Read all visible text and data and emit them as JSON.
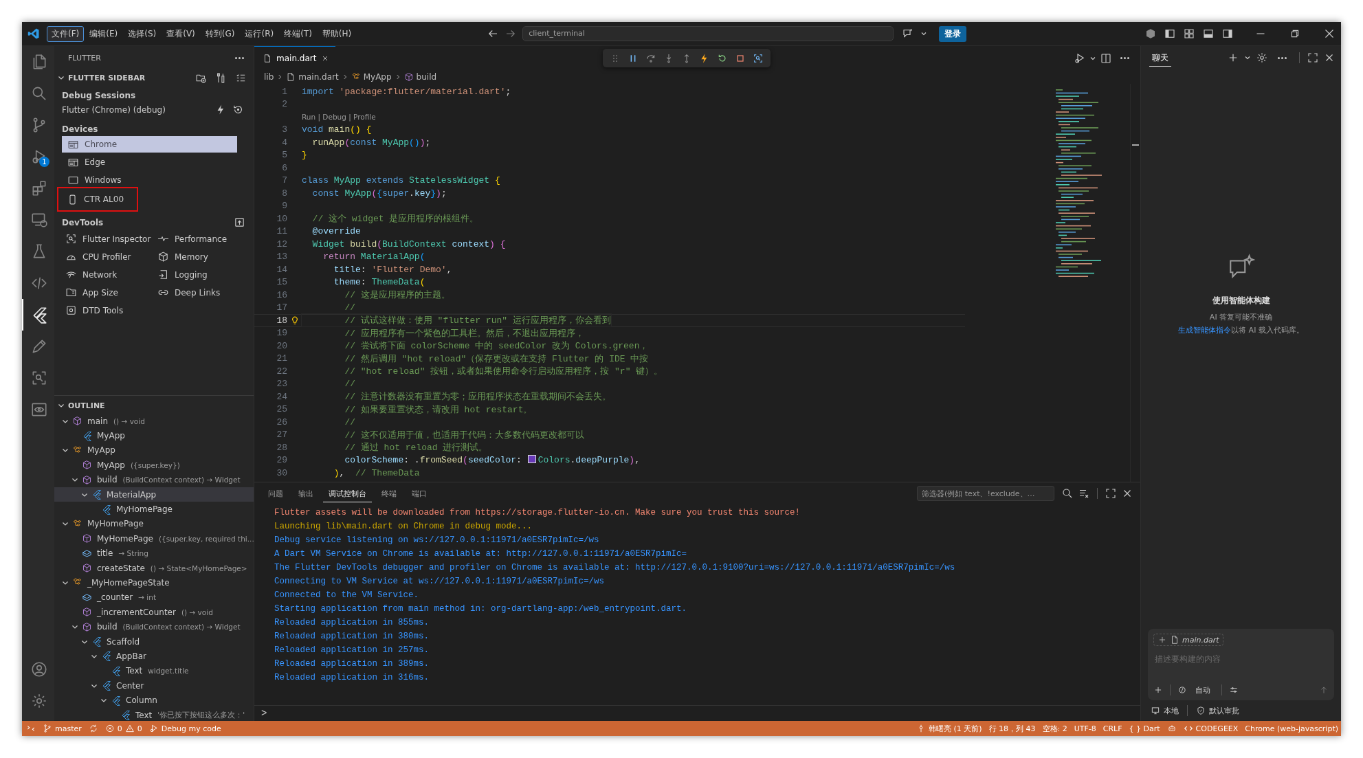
{
  "menu_bar": [
    {
      "label": "文件(F)",
      "selected": true
    },
    {
      "label": "编辑(E)",
      "selected": false
    },
    {
      "label": "选择(S)",
      "selected": false
    },
    {
      "label": "查看(V)",
      "selected": false
    },
    {
      "label": "转到(G)",
      "selected": false
    },
    {
      "label": "运行(R)",
      "selected": false
    },
    {
      "label": "终端(T)",
      "selected": false
    },
    {
      "label": "帮助(H)",
      "selected": false
    }
  ],
  "command_center": {
    "value": "client_terminal"
  },
  "sign_in_button": "登录",
  "activity_bar": [
    {
      "selected": false
    },
    {
      "selected": false
    },
    {
      "selected": false
    },
    {
      "selected": false,
      "badge": "1"
    },
    {
      "selected": false
    },
    {
      "selected": false
    },
    {
      "selected": false
    },
    {
      "selected": false
    },
    {
      "selected": true
    },
    {
      "selected": false
    },
    {
      "selected": false
    },
    {
      "selected": false
    }
  ],
  "sidebar": {
    "title": "FLUTTER",
    "section": {
      "title": "FLUTTER SIDEBAR",
      "expanded": true
    },
    "debug_sessions": {
      "heading": "Debug Sessions",
      "sessions": [
        "Flutter (Chrome) (debug)"
      ]
    },
    "devices": {
      "heading": "Devices",
      "items": [
        {
          "kind": "browser",
          "label": "Chrome",
          "selected": true,
          "annotated": false
        },
        {
          "kind": "browser",
          "label": "Edge",
          "selected": false,
          "annotated": false
        },
        {
          "kind": "desktop",
          "label": "Windows",
          "selected": false,
          "annotated": false
        },
        {
          "kind": "phone",
          "label": "CTR AL00",
          "selected": false,
          "annotated": true
        }
      ]
    },
    "devtools": {
      "heading": "DevTools",
      "items": [
        "Flutter Inspector",
        "Performance",
        "CPU Profiler",
        "Memory",
        "Network",
        "Logging",
        "App Size",
        "Deep Links",
        "DTD Tools"
      ]
    },
    "outline": {
      "title": "OUTLINE",
      "expanded": true,
      "items": [
        {
          "kind": "function",
          "name": "main",
          "detail": "() → void",
          "expanded": true,
          "selected": false,
          "children": [
            {
              "kind": "widget",
              "name": "MyApp",
              "selected": false
            }
          ]
        },
        {
          "kind": "class",
          "name": "MyApp",
          "expanded": true,
          "selected": false,
          "children": [
            {
              "kind": "function",
              "name": "MyApp",
              "detail": "({super.key})",
              "selected": false
            },
            {
              "kind": "function",
              "name": "build",
              "detail": "(BuildContext context) → Widget",
              "expanded": true,
              "selected": false,
              "children": [
                {
                  "kind": "widget",
                  "name": "MaterialApp",
                  "expanded": true,
                  "selected": true,
                  "children": [
                    {
                      "kind": "widget",
                      "name": "MyHomePage",
                      "selected": false
                    }
                  ]
                }
              ]
            }
          ]
        },
        {
          "kind": "class",
          "name": "MyHomePage",
          "expanded": true,
          "selected": false,
          "children": [
            {
              "kind": "function",
              "name": "MyHomePage",
              "detail": "({super.key, required thi...",
              "selected": false
            },
            {
              "kind": "field",
              "name": "title",
              "detail": "→ String",
              "selected": false
            },
            {
              "kind": "function",
              "name": "createState",
              "detail": "() → State<MyHomePage>",
              "selected": false
            }
          ]
        },
        {
          "kind": "class",
          "name": "_MyHomePageState",
          "expanded": true,
          "selected": false,
          "children": [
            {
              "kind": "field",
              "name": "_counter",
              "detail": "→ int",
              "selected": false
            },
            {
              "kind": "function",
              "name": "_incrementCounter",
              "detail": "() → void",
              "selected": false
            },
            {
              "kind": "function",
              "name": "build",
              "detail": "(BuildContext context) → Widget",
              "expanded": true,
              "selected": false,
              "children": [
                {
                  "kind": "widget",
                  "name": "Scaffold",
                  "expanded": true,
                  "selected": false,
                  "children": [
                    {
                      "kind": "widget",
                      "name": "AppBar",
                      "expanded": true,
                      "selected": false,
                      "children": [
                        {
                          "kind": "widget",
                          "name": "Text",
                          "detail": "widget.title",
                          "selected": false
                        }
                      ]
                    },
                    {
                      "kind": "widget",
                      "name": "Center",
                      "expanded": true,
                      "selected": false,
                      "children": [
                        {
                          "kind": "widget",
                          "name": "Column",
                          "expanded": true,
                          "selected": false,
                          "children": [
                            {
                              "kind": "widget",
                              "name": "Text",
                              "detail": "'你已按下按钮这么多次：'",
                              "selected": false
                            }
                          ]
                        }
                      ]
                    }
                  ]
                }
              ]
            }
          ]
        }
      ]
    }
  },
  "editor": {
    "tabs": [
      {
        "label": "main.dart",
        "selected": true
      }
    ],
    "breadcrumb": [
      {
        "kind": "folder",
        "label": "lib"
      },
      {
        "kind": "file",
        "label": "main.dart"
      },
      {
        "kind": "class",
        "label": "MyApp"
      },
      {
        "kind": "method",
        "label": "build"
      }
    ],
    "lines": [
      {
        "kind": "code",
        "number": "1",
        "current": false,
        "segments": [
          {
            "kind": "keyword",
            "text": "import "
          },
          {
            "kind": "string",
            "text": "'package:flutter/material.dart'"
          },
          {
            "kind": "plain",
            "text": ";"
          }
        ]
      },
      {
        "kind": "code",
        "number": "2",
        "current": false
      },
      {
        "kind": "lens",
        "text": "Run | Debug | Profile"
      },
      {
        "kind": "code",
        "number": "3",
        "current": false,
        "segments": [
          {
            "kind": "keyword",
            "text": "void "
          },
          {
            "kind": "function",
            "text": "main"
          },
          {
            "kind": "bracket1",
            "text": "() {"
          }
        ]
      },
      {
        "kind": "code",
        "number": "4",
        "current": false,
        "segments": [
          {
            "kind": "function",
            "text": "  runApp"
          },
          {
            "kind": "bracket2",
            "text": "("
          },
          {
            "kind": "keyword",
            "text": "const "
          },
          {
            "kind": "type",
            "text": "MyApp"
          },
          {
            "kind": "bracket3",
            "text": "()"
          },
          {
            "kind": "bracket2",
            "text": ")"
          },
          {
            "kind": "plain",
            "text": ";"
          }
        ]
      },
      {
        "kind": "code",
        "number": "5",
        "current": false,
        "segments": [
          {
            "kind": "bracket1",
            "text": "}"
          }
        ]
      },
      {
        "kind": "code",
        "number": "6",
        "current": false
      },
      {
        "kind": "code",
        "number": "7",
        "current": false,
        "segments": [
          {
            "kind": "keyword",
            "text": "class "
          },
          {
            "kind": "type",
            "text": "MyApp "
          },
          {
            "kind": "keyword",
            "text": "extends "
          },
          {
            "kind": "type",
            "text": "StatelessWidget "
          },
          {
            "kind": "bracket1",
            "text": "{"
          }
        ]
      },
      {
        "kind": "code",
        "number": "8",
        "current": false,
        "segments": [
          {
            "kind": "keyword",
            "text": "  const "
          },
          {
            "kind": "type",
            "text": "MyApp"
          },
          {
            "kind": "bracket2",
            "text": "("
          },
          {
            "kind": "bracket3",
            "text": "{"
          },
          {
            "kind": "keyword",
            "text": "super"
          },
          {
            "kind": "plain",
            "text": "."
          },
          {
            "kind": "variable",
            "text": "key"
          },
          {
            "kind": "bracket3",
            "text": "}"
          },
          {
            "kind": "bracket2",
            "text": ")"
          },
          {
            "kind": "plain",
            "text": ";"
          }
        ]
      },
      {
        "kind": "code",
        "number": "9",
        "current": false
      },
      {
        "kind": "code",
        "number": "10",
        "current": false,
        "segments": [
          {
            "kind": "comment",
            "text": "  // 这个 widget 是应用程序的根组件。"
          }
        ]
      },
      {
        "kind": "code",
        "number": "11",
        "current": false,
        "segments": [
          {
            "kind": "variable",
            "text": "  @override"
          }
        ]
      },
      {
        "kind": "code",
        "number": "12",
        "current": false,
        "segments": [
          {
            "kind": "type",
            "text": "  Widget "
          },
          {
            "kind": "function",
            "text": "build"
          },
          {
            "kind": "bracket2",
            "text": "("
          },
          {
            "kind": "type",
            "text": "BuildContext "
          },
          {
            "kind": "variable",
            "text": "context"
          },
          {
            "kind": "bracket2",
            "text": ") {"
          }
        ]
      },
      {
        "kind": "code",
        "number": "13",
        "current": false,
        "segments": [
          {
            "kind": "control",
            "text": "    return "
          },
          {
            "kind": "type",
            "text": "MaterialApp"
          },
          {
            "kind": "bracket3",
            "text": "("
          }
        ]
      },
      {
        "kind": "code",
        "number": "14",
        "current": false,
        "segments": [
          {
            "kind": "variable",
            "text": "      title"
          },
          {
            "kind": "plain",
            "text": ": "
          },
          {
            "kind": "string",
            "text": "'Flutter Demo'"
          },
          {
            "kind": "plain",
            "text": ","
          }
        ]
      },
      {
        "kind": "code",
        "number": "15",
        "current": false,
        "segments": [
          {
            "kind": "variable",
            "text": "      theme"
          },
          {
            "kind": "plain",
            "text": ": "
          },
          {
            "kind": "type",
            "text": "ThemeData"
          },
          {
            "kind": "bracket1",
            "text": "("
          }
        ]
      },
      {
        "kind": "code",
        "number": "16",
        "current": false,
        "segments": [
          {
            "kind": "comment",
            "text": "        // 这是应用程序的主题。"
          }
        ]
      },
      {
        "kind": "code",
        "number": "17",
        "current": false,
        "segments": [
          {
            "kind": "comment",
            "text": "        //"
          }
        ]
      },
      {
        "kind": "code",
        "number": "18",
        "current": true,
        "segments": [
          {
            "kind": "comment",
            "text": "        // 试试这样做：使用 \"flutter run\" 运行应用程序，你会看到"
          }
        ]
      },
      {
        "kind": "code",
        "number": "19",
        "current": false,
        "segments": [
          {
            "kind": "comment",
            "text": "        // 应用程序有一个紫色的工具栏。然后，不退出应用程序，"
          }
        ]
      },
      {
        "kind": "code",
        "number": "20",
        "current": false,
        "segments": [
          {
            "kind": "comment",
            "text": "        // 尝试将下面 colorScheme 中的 seedColor 改为 Colors.green，"
          }
        ]
      },
      {
        "kind": "code",
        "number": "21",
        "current": false,
        "segments": [
          {
            "kind": "comment",
            "text": "        // 然后调用 \"hot reload\"（保存更改或在支持 Flutter 的 IDE 中按"
          }
        ]
      },
      {
        "kind": "code",
        "number": "22",
        "current": false,
        "segments": [
          {
            "kind": "comment",
            "text": "        // \"hot reload\" 按钮，或者如果使用命令行启动应用程序，按 \"r\" 键）。"
          }
        ]
      },
      {
        "kind": "code",
        "number": "23",
        "current": false,
        "segments": [
          {
            "kind": "comment",
            "text": "        //"
          }
        ]
      },
      {
        "kind": "code",
        "number": "24",
        "current": false,
        "segments": [
          {
            "kind": "comment",
            "text": "        // 注意计数器没有重置为零；应用程序状态在重载期间不会丢失。"
          }
        ]
      },
      {
        "kind": "code",
        "number": "25",
        "current": false,
        "segments": [
          {
            "kind": "comment",
            "text": "        // 如果要重置状态，请改用 hot restart。"
          }
        ]
      },
      {
        "kind": "code",
        "number": "26",
        "current": false,
        "segments": [
          {
            "kind": "comment",
            "text": "        //"
          }
        ]
      },
      {
        "kind": "code",
        "number": "27",
        "current": false,
        "segments": [
          {
            "kind": "comment",
            "text": "        // 这不仅适用于值，也适用于代码：大多数代码更改都可以"
          }
        ]
      },
      {
        "kind": "code",
        "number": "28",
        "current": false,
        "segments": [
          {
            "kind": "comment",
            "text": "        // 通过 hot reload 进行测试。"
          }
        ]
      },
      {
        "kind": "code",
        "number": "29",
        "current": false,
        "segments": [
          {
            "kind": "variable",
            "text": "        colorScheme"
          },
          {
            "kind": "plain",
            "text": ": ."
          },
          {
            "kind": "function",
            "text": "fromSeed"
          },
          {
            "kind": "bracket2",
            "text": "("
          },
          {
            "kind": "variable",
            "text": "seedColor"
          },
          {
            "kind": "plain",
            "text": ": "
          },
          {
            "kind": "swatch",
            "color": "#673ab7"
          },
          {
            "kind": "type",
            "text": "Colors"
          },
          {
            "kind": "plain",
            "text": "."
          },
          {
            "kind": "variable",
            "text": "deepPurple"
          },
          {
            "kind": "bracket2",
            "text": ")"
          },
          {
            "kind": "plain",
            "text": ","
          }
        ]
      },
      {
        "kind": "code",
        "number": "30",
        "current": false,
        "segments": [
          {
            "kind": "bracket1",
            "text": "      )"
          },
          {
            "kind": "plain",
            "text": ",  "
          },
          {
            "kind": "comment",
            "text": "// ThemeData"
          }
        ]
      }
    ]
  },
  "panel": {
    "tabs": [
      {
        "label": "问题",
        "selected": false
      },
      {
        "label": "输出",
        "selected": false
      },
      {
        "label": "调试控制台",
        "selected": true
      },
      {
        "label": "终端",
        "selected": false
      },
      {
        "label": "端口",
        "selected": false
      }
    ],
    "filter": {
      "placeholder": "筛选器(例如 text、!exclude、…"
    },
    "output": [
      {
        "kind": "error",
        "text": "Flutter assets will be downloaded from https://storage.flutter-io.cn. Make sure you trust this source!"
      },
      {
        "kind": "warning",
        "text": "Launching lib\\main.dart on Chrome in debug mode..."
      },
      {
        "kind": "info",
        "text": "Debug service listening on ws://127.0.0.1:11971/a0ESR7pimIc=/ws"
      },
      {
        "kind": "info",
        "text": "A Dart VM Service on Chrome is available at: http://127.0.0.1:11971/a0ESR7pimIc="
      },
      {
        "kind": "info",
        "text": "The Flutter DevTools debugger and profiler on Chrome is available at: http://127.0.0.1:9100?uri=ws://127.0.0.1:11971/a0ESR7pimIc=/ws"
      },
      {
        "kind": "info",
        "text": "Connecting to VM Service at ws://127.0.0.1:11971/a0ESR7pimIc=/ws"
      },
      {
        "kind": "info",
        "text": "Connected to the VM Service."
      },
      {
        "kind": "info",
        "text": "Starting application from main method in: org-dartlang-app:/web_entrypoint.dart."
      },
      {
        "kind": "info",
        "text": "Reloaded application in 855ms."
      },
      {
        "kind": "info",
        "text": "Reloaded application in 380ms."
      },
      {
        "kind": "info",
        "text": "Reloaded application in 257ms."
      },
      {
        "kind": "info",
        "text": "Reloaded application in 389ms."
      },
      {
        "kind": "info",
        "text": "Reloaded application in 316ms."
      }
    ],
    "prompt": ">"
  },
  "chat": {
    "tabs": [
      {
        "label": "聊天",
        "selected": true
      }
    ],
    "empty_state": {
      "title": "使用智能体构建",
      "subtitle": "AI 答复可能不准确",
      "link": "生成智能体指令",
      "hint": "以将 AI 载入代码库。"
    },
    "input": {
      "attachment": "main.dart",
      "placeholder": "描述要构建的内容",
      "mode": "自动"
    },
    "footer": [
      "本地",
      "默认审批"
    ]
  },
  "status_bar": {
    "branch": "master",
    "errors": "0",
    "warnings": "0",
    "debug": "Debug my code",
    "blame": "韩曙亮 (1 天前)",
    "position": "行 18，列 43",
    "indent": "空格: 2",
    "encoding": "UTF-8",
    "eol": "CRLF",
    "language_glyph": "{ }",
    "language": "Dart",
    "extension": "CODEGEEX",
    "debug_target": "Chrome (web-javascript)"
  }
}
